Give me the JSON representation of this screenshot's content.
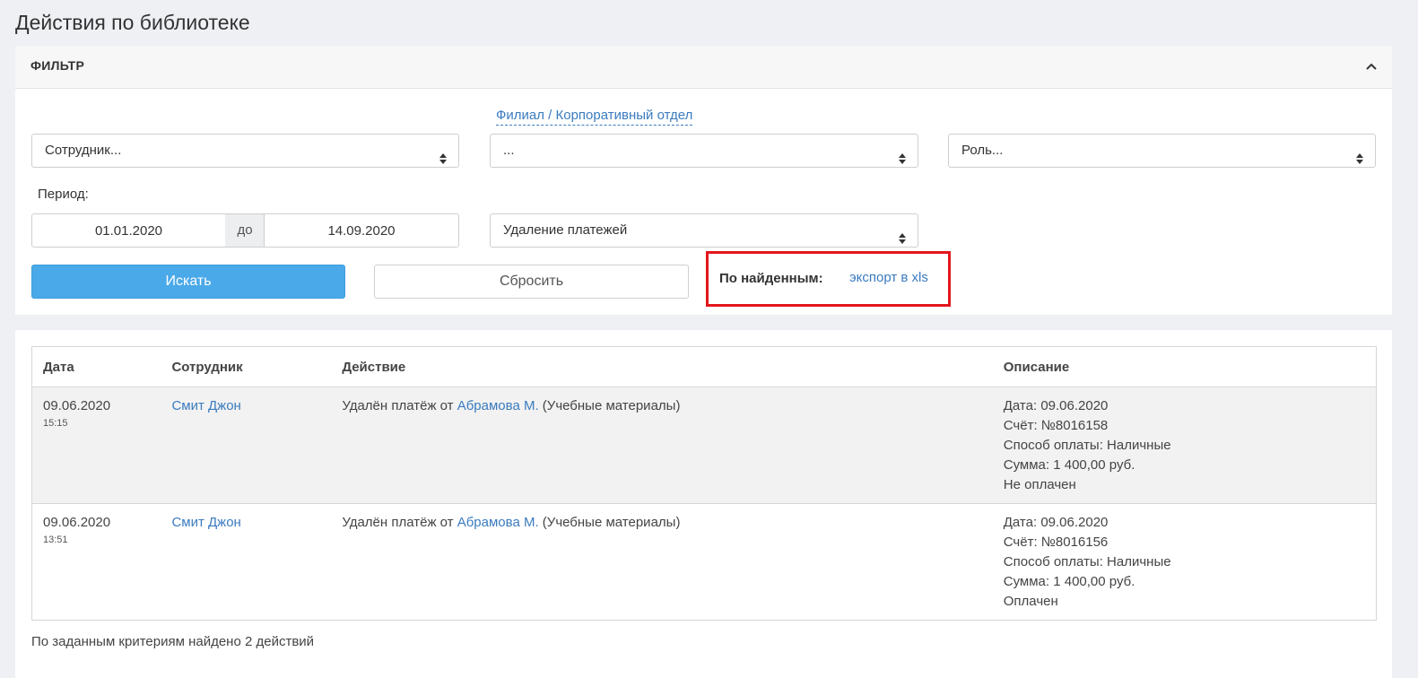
{
  "page": {
    "title": "Действия по библиотеке"
  },
  "filter": {
    "title": "ФИЛЬТР",
    "branch_link": "Филиал / Корпоративный отдел",
    "employee_select": "Сотрудник...",
    "branch_select": "...",
    "role_select": "Роль...",
    "period_label": "Период:",
    "date_from": "01.01.2020",
    "date_separator": "до",
    "date_to": "14.09.2020",
    "action_select": "Удаление платежей",
    "search_button": "Искать",
    "reset_button": "Сбросить",
    "export_label": "По найденным:",
    "export_link": "экспорт в xls"
  },
  "table": {
    "headers": [
      "Дата",
      "Сотрудник",
      "Действие",
      "Описание"
    ],
    "rows": [
      {
        "date": "09.06.2020",
        "time": "15:15",
        "employee": "Смит Джон",
        "action_prefix": "Удалён платёж от",
        "action_person": "Абрамова М.",
        "action_suffix": "(Учебные материалы)",
        "description": [
          "Дата: 09.06.2020",
          "Счёт: №8016158",
          "Способ оплаты: Наличные",
          "Сумма: 1 400,00 руб.",
          "Не оплачен"
        ]
      },
      {
        "date": "09.06.2020",
        "time": "13:51",
        "employee": "Смит Джон",
        "action_prefix": "Удалён платёж от",
        "action_person": "Абрамова М.",
        "action_suffix": "(Учебные материалы)",
        "description": [
          "Дата: 09.06.2020",
          "Счёт: №8016156",
          "Способ оплаты: Наличные",
          "Сумма: 1 400,00 руб.",
          "Оплачен"
        ]
      }
    ]
  },
  "summary": "По заданным критериям найдено 2 действий",
  "colors": {
    "accent": "#4aa9e8",
    "link": "#3a7bbf",
    "highlight_border": "#e3161c"
  },
  "icons": {
    "collapse": "chevron-up-icon",
    "select_arrows": "sort-arrows-icon"
  }
}
